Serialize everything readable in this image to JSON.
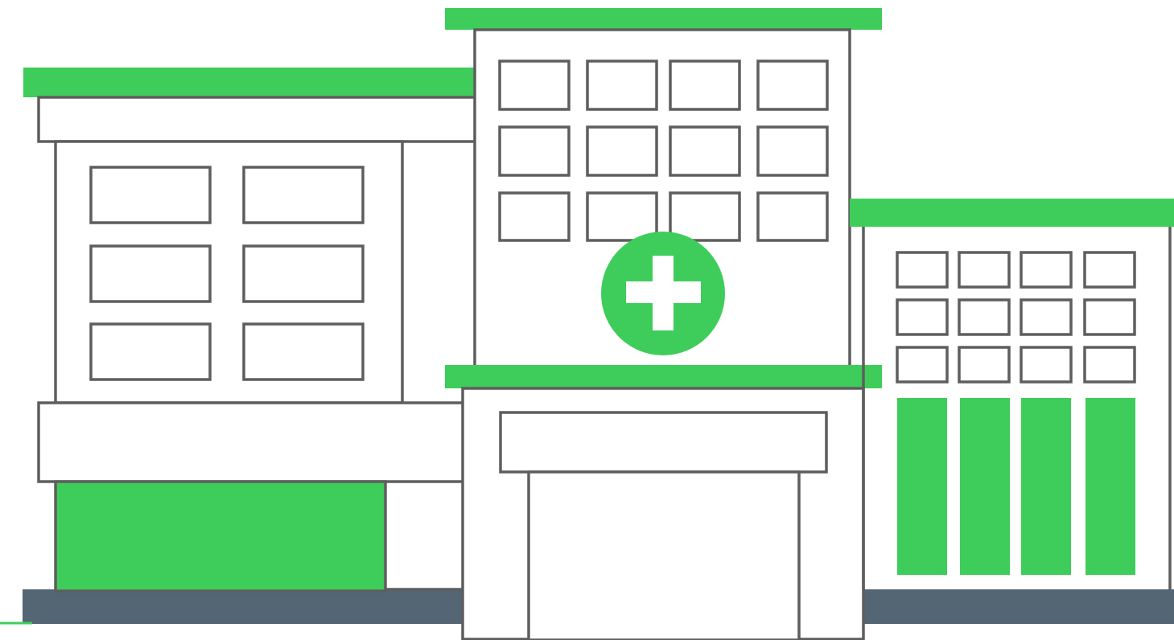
{
  "illustration": {
    "subject": "hospital",
    "icon": "medical-cross-icon"
  },
  "palette": {
    "accent": "#3ecd5a",
    "outline": "#5e5e5e",
    "ground": "#546574",
    "background": "#ffffff"
  }
}
